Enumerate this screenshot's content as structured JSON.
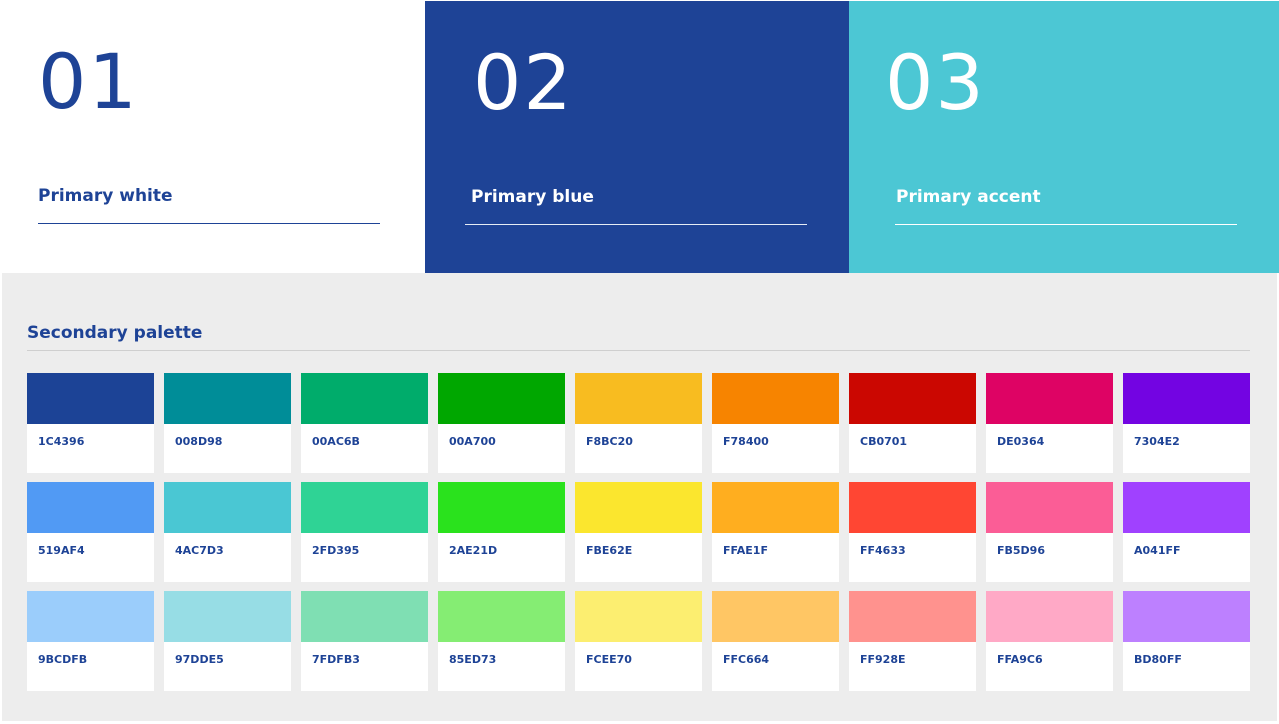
{
  "primary": {
    "white": {
      "number": "01",
      "title": "Primary white",
      "color": "#ffffff"
    },
    "blue": {
      "number": "02",
      "title": "Primary blue",
      "color": "#1e4396"
    },
    "accent": {
      "number": "03",
      "title": "Primary accent",
      "color": "#4cc7d4"
    }
  },
  "secondary": {
    "title": "Secondary palette",
    "rows": [
      [
        "1C4396",
        "008D98",
        "00AC6B",
        "00A700",
        "F8BC20",
        "F78400",
        "CB0701",
        "DE0364",
        "7304E2"
      ],
      [
        "519AF4",
        "4AC7D3",
        "2FD395",
        "2AE21D",
        "FBE62E",
        "FFAE1F",
        "FF4633",
        "FB5D96",
        "A041FF"
      ],
      [
        "9BCDFB",
        "97DDE5",
        "7FDFB3",
        "85ED73",
        "FCEE70",
        "FFC664",
        "FF928E",
        "FFA9C6",
        "BD80FF"
      ]
    ]
  }
}
